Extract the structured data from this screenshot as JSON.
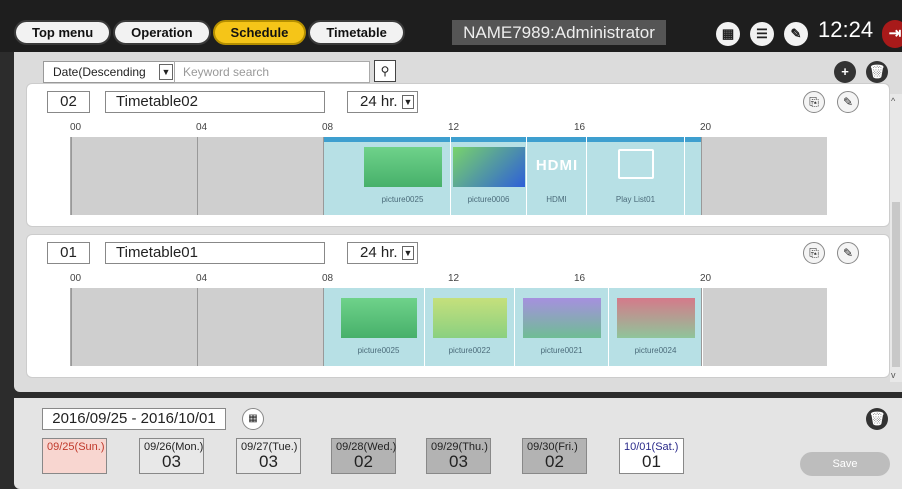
{
  "nav": {
    "tabs": [
      {
        "label": "Top menu",
        "active": false
      },
      {
        "label": "Operation",
        "active": false
      },
      {
        "label": "Schedule",
        "active": true
      },
      {
        "label": "Timetable",
        "active": false
      }
    ],
    "user": "NAME7989:Administrator",
    "time": "12:24",
    "icons": [
      "calendar-icon",
      "list-icon",
      "wrench-icon",
      "logout-icon"
    ]
  },
  "toolbar": {
    "sort_value": "Date(Descending",
    "search_placeholder": "Keyword search"
  },
  "ruler": [
    "00",
    "04",
    "08",
    "12",
    "16",
    "20"
  ],
  "timetables": [
    {
      "number": "02",
      "name": "Timetable02",
      "mode": "24 hr.",
      "items": [
        {
          "label": "picture0025",
          "kind": "picture",
          "color": "#5cc27a"
        },
        {
          "label": "picture0006",
          "kind": "picture",
          "color": "#3a78d6"
        },
        {
          "label": "HDMI",
          "kind": "hdmi",
          "color": "#ffffff"
        },
        {
          "label": "Play List01",
          "kind": "playlist",
          "color": "#ffffff"
        }
      ]
    },
    {
      "number": "01",
      "name": "Timetable01",
      "mode": "24 hr.",
      "items": [
        {
          "label": "picture0025",
          "kind": "picture",
          "color": "#5cc27a"
        },
        {
          "label": "picture0022",
          "kind": "picture",
          "color": "#b9e07a"
        },
        {
          "label": "picture0021",
          "kind": "picture",
          "color": "#9b86d9"
        },
        {
          "label": "picture0024",
          "kind": "picture",
          "color": "#d57a8a"
        }
      ]
    }
  ],
  "week": {
    "range": "2016/09/25 - 2016/10/01",
    "days": [
      {
        "label": "09/25(Sun.)",
        "value": "",
        "bg": "#f8d6d0",
        "text": "#c0392b"
      },
      {
        "label": "09/26(Mon.)",
        "value": "03",
        "bg": "#e8e8e8",
        "text": "#222222"
      },
      {
        "label": "09/27(Tue.)",
        "value": "03",
        "bg": "#e8e8e8",
        "text": "#222222"
      },
      {
        "label": "09/28(Wed.)",
        "value": "02",
        "bg": "#b3b3b3",
        "text": "#222222"
      },
      {
        "label": "09/29(Thu.)",
        "value": "03",
        "bg": "#b3b3b3",
        "text": "#222222"
      },
      {
        "label": "09/30(Fri.)",
        "value": "02",
        "bg": "#b3b3b3",
        "text": "#222222"
      },
      {
        "label": "10/01(Sat.)",
        "value": "01",
        "bg": "#ffffff",
        "text": "#2a2a8a"
      }
    ],
    "save_label": "Save"
  }
}
